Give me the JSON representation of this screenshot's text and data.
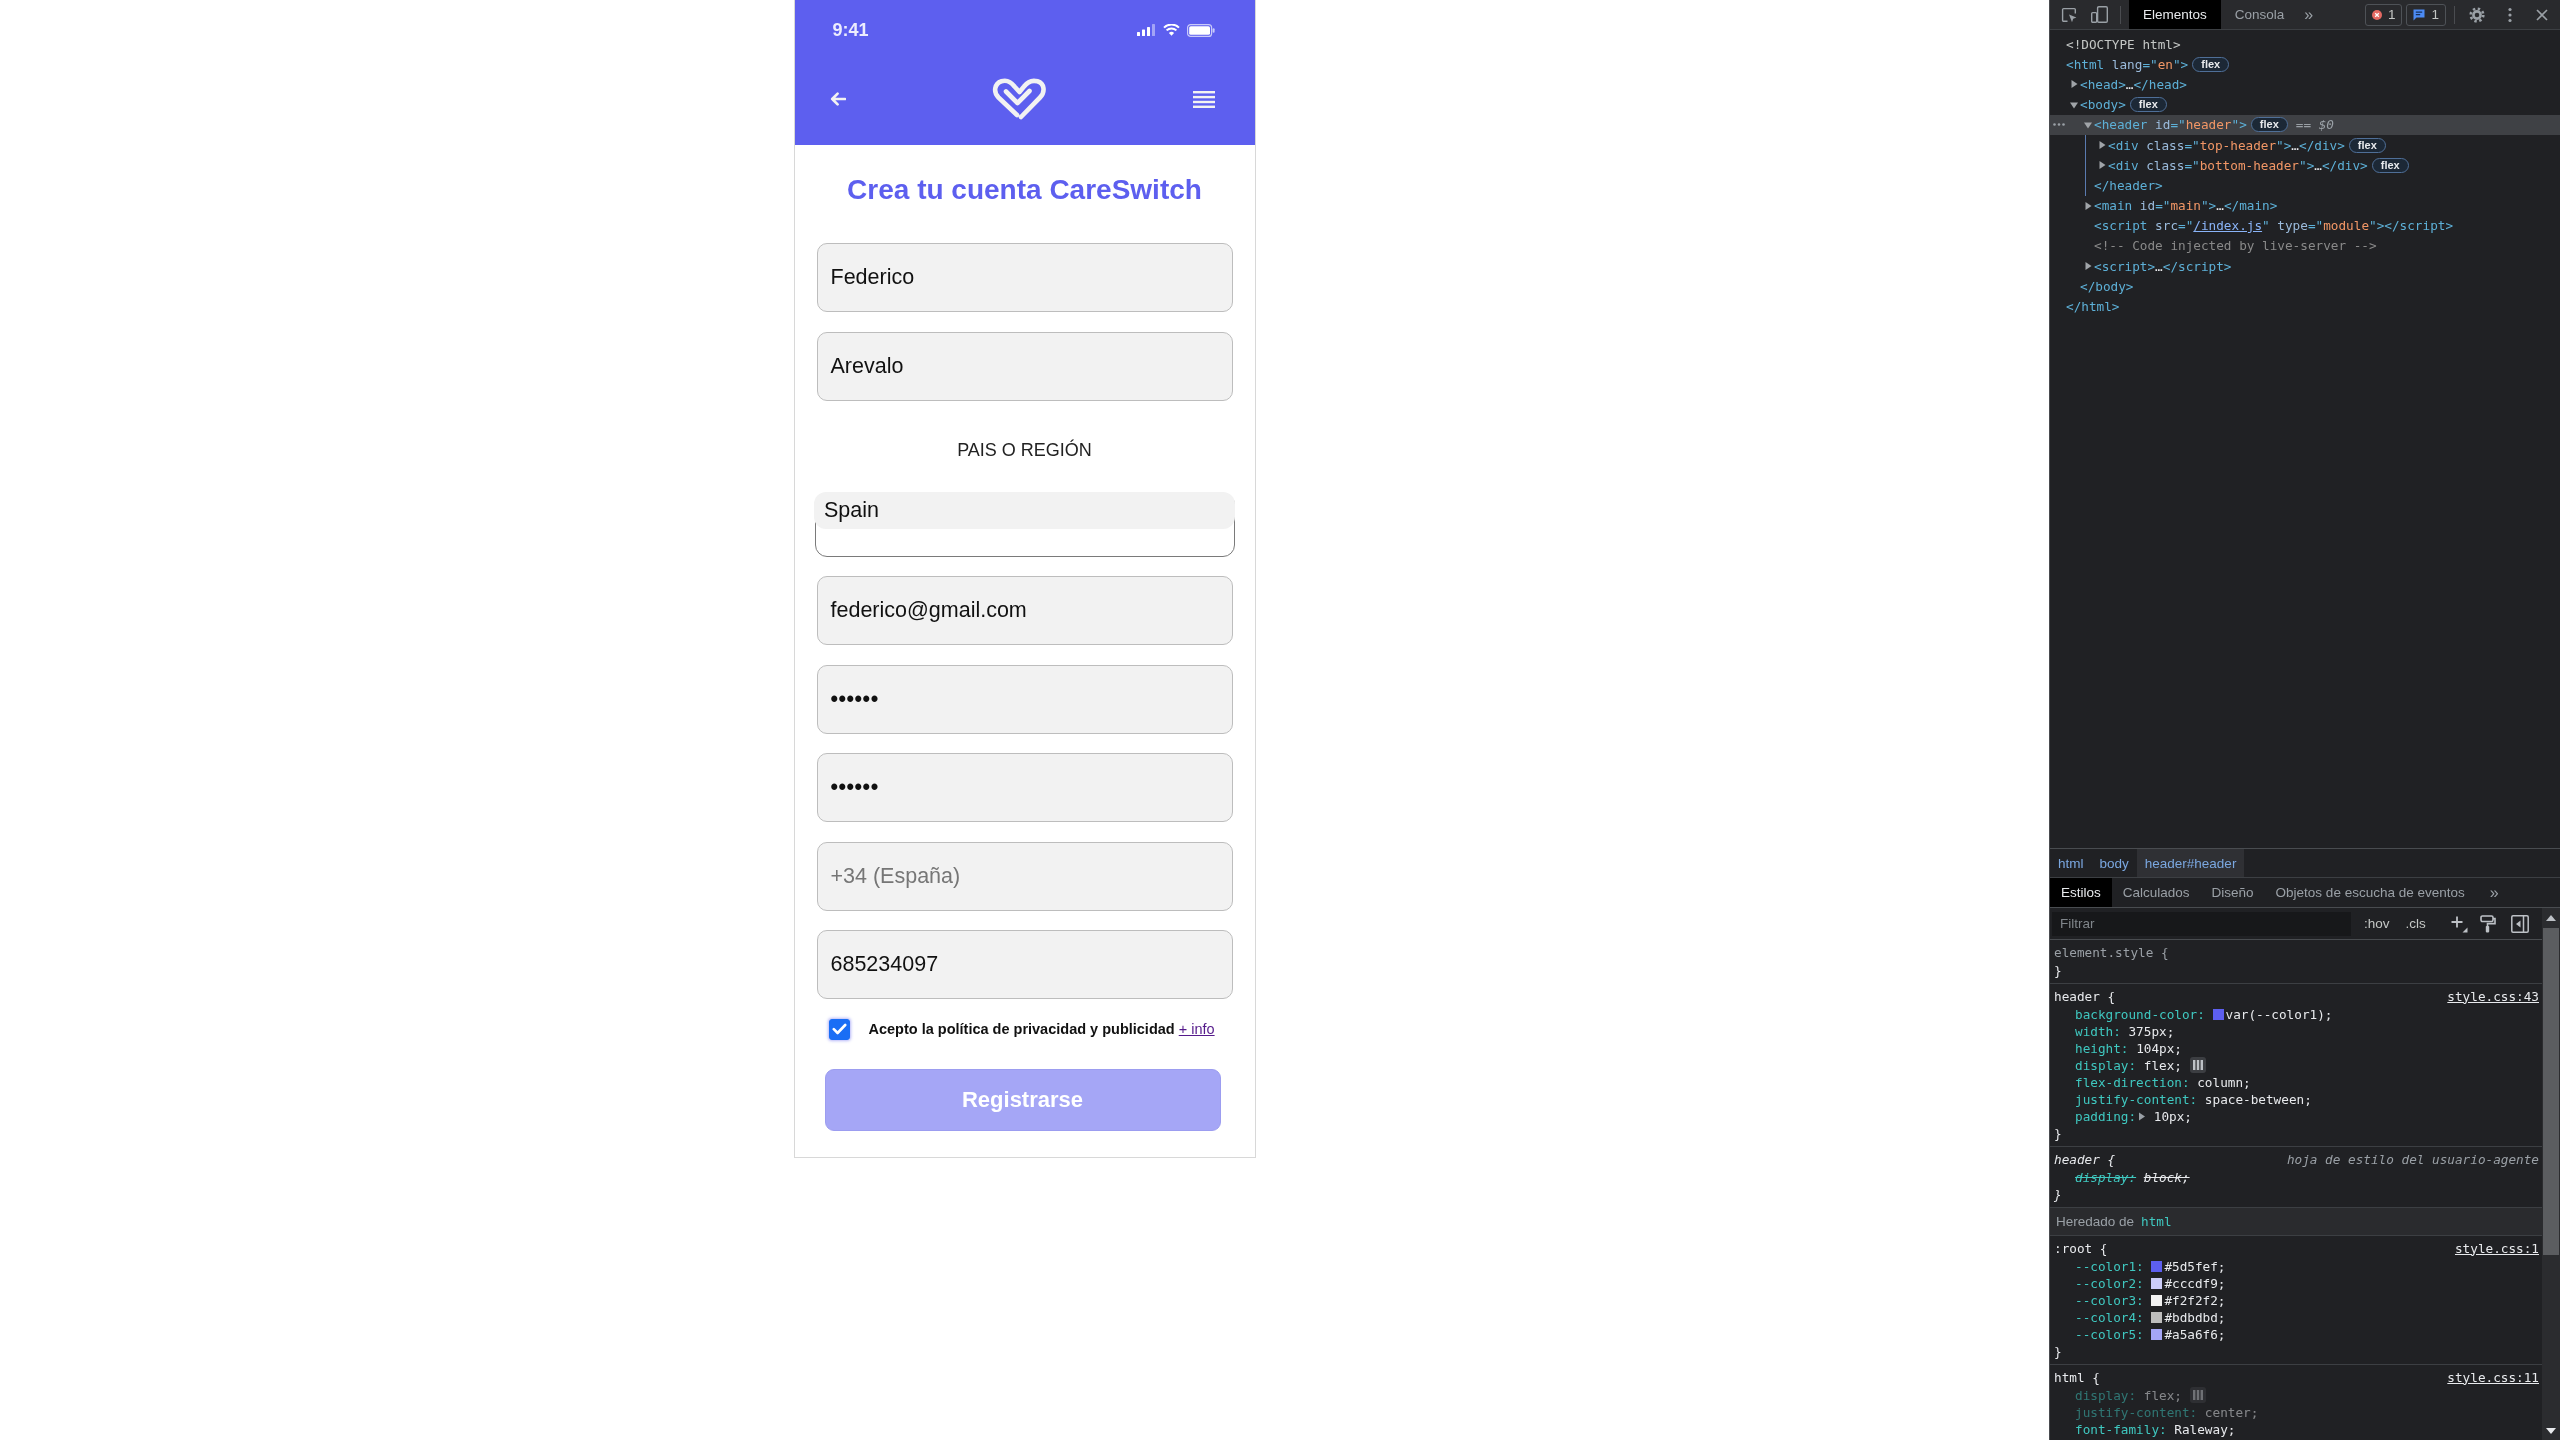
{
  "phone": {
    "status_bar": {
      "time": "9:41"
    },
    "title": "Crea tu cuenta CareSwitch",
    "form": [
      {
        "kind": "text",
        "value": "Federico"
      },
      {
        "kind": "text",
        "value": "Arevalo"
      },
      {
        "kind": "label",
        "text": "PAIS O REGIÓN"
      },
      {
        "kind": "select",
        "value": "Spain"
      },
      {
        "kind": "email",
        "value": "federico@gmail.com"
      },
      {
        "kind": "password",
        "value": "••••••"
      },
      {
        "kind": "password",
        "value": "••••••"
      },
      {
        "kind": "tel",
        "placeholder": "+34 (España)"
      },
      {
        "kind": "tel",
        "value": "685234097"
      }
    ],
    "consent": {
      "checked": true,
      "text": "Acepto la política de privacidad y publicidad",
      "link": "+ info"
    },
    "submit": {
      "label": "Registrarse"
    }
  },
  "devtools": {
    "toolbar": {
      "tabs": [
        {
          "label": "Elementos",
          "selected": true
        },
        {
          "label": "Consola",
          "selected": false
        }
      ],
      "more": "»",
      "error_count": "1",
      "message_count": "1"
    },
    "dom_tree": [
      {
        "selected": false,
        "line": [
          {
            "kind": "doctype",
            "text": "<!DOCTYPE html>"
          }
        ]
      },
      {
        "selected": false,
        "line": [
          {
            "kind": "tag",
            "text": "<html "
          },
          {
            "kind": "attr",
            "text": "lang"
          },
          {
            "kind": "tag",
            "text": "=\""
          },
          {
            "kind": "value",
            "text": "en"
          },
          {
            "kind": "tag",
            "text": "\">"
          }
        ],
        "badge": "flex",
        "children": [
          {
            "selected": false,
            "expanded": false,
            "line": [
              {
                "kind": "tag",
                "text": "<head>"
              },
              {
                "kind": "text",
                "text": "…"
              },
              {
                "kind": "tag",
                "text": "</head>"
              }
            ]
          },
          {
            "selected": false,
            "expanded": true,
            "line": [
              {
                "kind": "tag",
                "text": "<body>"
              }
            ],
            "badge": "flex",
            "children": [
              {
                "selected": true,
                "expanded": true,
                "line": [
                  {
                    "kind": "tag",
                    "text": "<header "
                  },
                  {
                    "kind": "attr",
                    "text": "id"
                  },
                  {
                    "kind": "tag",
                    "text": "=\""
                  },
                  {
                    "kind": "value",
                    "text": "header"
                  },
                  {
                    "kind": "tag",
                    "text": "\">"
                  }
                ],
                "badge": "flex",
                "marker": "== $0",
                "children": [
                  {
                    "selected": false,
                    "expanded": false,
                    "line": [
                      {
                        "kind": "tag",
                        "text": "<div "
                      },
                      {
                        "kind": "attr",
                        "text": "class"
                      },
                      {
                        "kind": "tag",
                        "text": "=\""
                      },
                      {
                        "kind": "value",
                        "text": "top-header"
                      },
                      {
                        "kind": "tag",
                        "text": "\">"
                      },
                      {
                        "kind": "text",
                        "text": "…"
                      },
                      {
                        "kind": "tag",
                        "text": "</div>"
                      }
                    ],
                    "badge": "flex"
                  },
                  {
                    "selected": false,
                    "expanded": false,
                    "line": [
                      {
                        "kind": "tag",
                        "text": "<div "
                      },
                      {
                        "kind": "attr",
                        "text": "class"
                      },
                      {
                        "kind": "tag",
                        "text": "=\""
                      },
                      {
                        "kind": "value",
                        "text": "bottom-header"
                      },
                      {
                        "kind": "tag",
                        "text": "\">"
                      },
                      {
                        "kind": "text",
                        "text": "…"
                      },
                      {
                        "kind": "tag",
                        "text": "</div>"
                      }
                    ],
                    "badge": "flex"
                  }
                ],
                "end": [
                  {
                    "kind": "tag",
                    "text": "</header>"
                  }
                ]
              },
              {
                "selected": false,
                "expanded": false,
                "line": [
                  {
                    "kind": "tag",
                    "text": "<main "
                  },
                  {
                    "kind": "attr",
                    "text": "id"
                  },
                  {
                    "kind": "tag",
                    "text": "=\""
                  },
                  {
                    "kind": "value",
                    "text": "main"
                  },
                  {
                    "kind": "tag",
                    "text": "\">"
                  },
                  {
                    "kind": "text",
                    "text": "…"
                  },
                  {
                    "kind": "tag",
                    "text": "</main>"
                  }
                ]
              },
              {
                "selected": false,
                "line": [
                  {
                    "kind": "tag",
                    "text": "<script "
                  },
                  {
                    "kind": "attr",
                    "text": "src"
                  },
                  {
                    "kind": "tag",
                    "text": "=\""
                  },
                  {
                    "kind": "link",
                    "text": "/index.js"
                  },
                  {
                    "kind": "tag",
                    "text": "\" "
                  },
                  {
                    "kind": "attr",
                    "text": "type"
                  },
                  {
                    "kind": "tag",
                    "text": "=\""
                  },
                  {
                    "kind": "value",
                    "text": "module"
                  },
                  {
                    "kind": "tag",
                    "text": "\"></script>"
                  }
                ]
              },
              {
                "selected": false,
                "line": [
                  {
                    "kind": "comment",
                    "text": "<!-- Code injected by live-server -->"
                  }
                ]
              },
              {
                "selected": false,
                "expanded": false,
                "line": [
                  {
                    "kind": "tag",
                    "text": "<script>"
                  },
                  {
                    "kind": "text",
                    "text": "…"
                  },
                  {
                    "kind": "tag",
                    "text": "</script>"
                  }
                ]
              }
            ],
            "end": [
              {
                "kind": "tag",
                "text": "</body>"
              }
            ]
          }
        ],
        "end": [
          {
            "kind": "tag",
            "text": "</html>"
          }
        ]
      }
    ],
    "breadcrumbs": [
      {
        "label": "html",
        "selected": false
      },
      {
        "label": "body",
        "selected": false
      },
      {
        "label": "header#header",
        "selected": true
      }
    ],
    "pane_tabs": [
      {
        "label": "Estilos",
        "selected": true
      },
      {
        "label": "Calculados",
        "selected": false
      },
      {
        "label": "Diseño",
        "selected": false
      },
      {
        "label": "Objetos de escucha de eventos",
        "selected": false
      }
    ],
    "pane_more": "»",
    "filter": {
      "placeholder": "Filtrar"
    },
    "filter_buttons": [
      ":hov",
      ".cls"
    ],
    "rules": [
      {
        "kind": "inline",
        "selector": "element.style {",
        "close": "}"
      },
      {
        "kind": "author",
        "selector": "header {",
        "source": "style.css:43",
        "close": "}",
        "declarations": [
          {
            "kind": "color",
            "name": "background-color:",
            "color": "#5d5fef",
            "value": "var(--color1);",
            "overridden": false,
            "inactive": false
          },
          {
            "kind": "plain",
            "name": "width:",
            "value": "375px;",
            "overridden": false,
            "inactive": false
          },
          {
            "kind": "plain",
            "name": "height:",
            "value": "104px;",
            "overridden": false,
            "inactive": false
          },
          {
            "kind": "flex",
            "name": "display:",
            "value": "flex;",
            "overridden": false,
            "inactive": false
          },
          {
            "kind": "plain",
            "name": "flex-direction:",
            "value": "column;",
            "overridden": false,
            "inactive": false
          },
          {
            "kind": "plain",
            "name": "justify-content:",
            "value": "space-between;",
            "overridden": false,
            "inactive": false
          },
          {
            "kind": "shorthand",
            "name": "padding:",
            "expanded": false,
            "value": "10px;",
            "overridden": false,
            "inactive": false
          }
        ]
      },
      {
        "kind": "user_agent",
        "selector": "header {",
        "source": "hoja de estilo del usuario-agente",
        "close": "}",
        "declarations": [
          {
            "kind": "plain",
            "name": "display:",
            "value": "block;",
            "overridden": true,
            "inactive": false
          }
        ]
      },
      {
        "kind": "inherited",
        "label": "Heredado de",
        "element": "html"
      },
      {
        "kind": "author",
        "selector": ":root {",
        "source": "style.css:1",
        "close": "}",
        "declarations": [
          {
            "kind": "color",
            "name": "--color1:",
            "color": "#5d5fef",
            "value": "#5d5fef;",
            "overridden": false,
            "inactive": false
          },
          {
            "kind": "color",
            "name": "--color2:",
            "color": "#cccdf9",
            "value": "#cccdf9;",
            "overridden": false,
            "inactive": false
          },
          {
            "kind": "color",
            "name": "--color3:",
            "color": "#f2f2f2",
            "value": "#f2f2f2;",
            "overridden": false,
            "inactive": false
          },
          {
            "kind": "color",
            "name": "--color4:",
            "color": "#bdbdbd",
            "value": "#bdbdbd;",
            "overridden": false,
            "inactive": false
          },
          {
            "kind": "color",
            "name": "--color5:",
            "color": "#a5a6f6",
            "value": "#a5a6f6;",
            "overridden": false,
            "inactive": false
          }
        ]
      },
      {
        "kind": "author",
        "selector": "html {",
        "source": "style.css:11",
        "declarations": [
          {
            "kind": "flex",
            "name": "display:",
            "value": "flex;",
            "overridden": false,
            "inactive": true
          },
          {
            "kind": "plain",
            "name": "justify-content:",
            "value": "center;",
            "overridden": false,
            "inactive": true
          },
          {
            "kind": "plain",
            "name": "font-family:",
            "value": "Raleway;",
            "overridden": false,
            "inactive": false
          }
        ]
      }
    ]
  }
}
